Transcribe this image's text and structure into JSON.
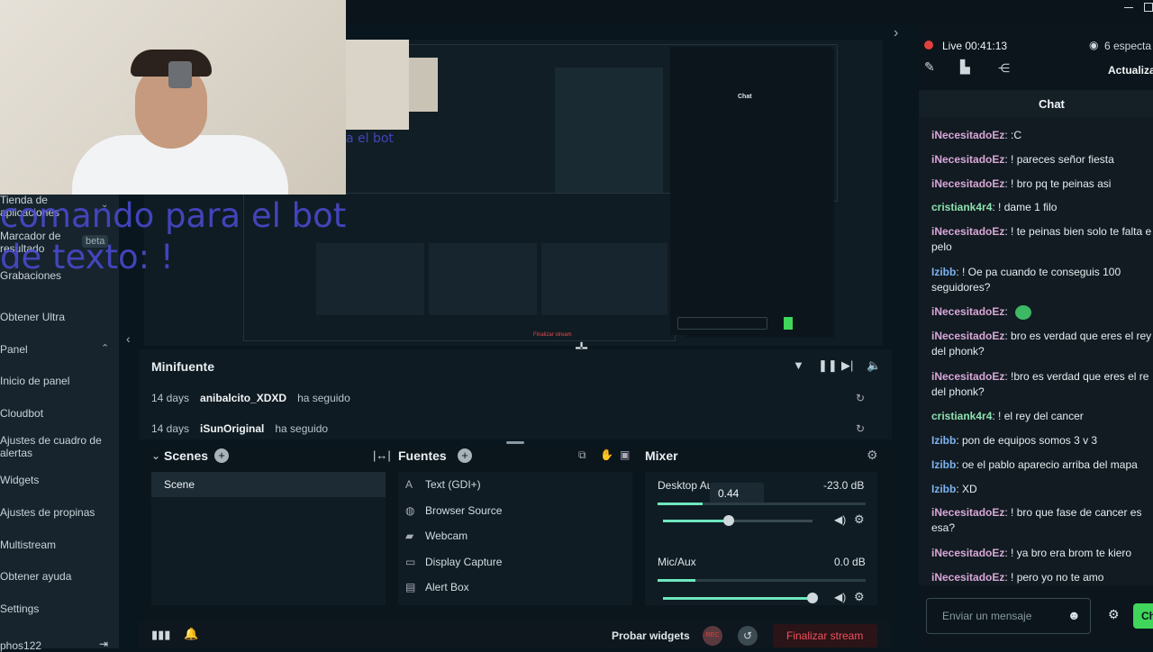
{
  "sidebar": {
    "items": [
      {
        "label": "Tienda de aplicaciones"
      },
      {
        "label": "Marcador de resultado",
        "badge": "beta"
      },
      {
        "label": "Grabaciones"
      },
      {
        "label": "Obtener Ultra"
      },
      {
        "label": "Panel"
      },
      {
        "label": "Inicio de panel"
      },
      {
        "label": "Cloudbot"
      },
      {
        "label": "Ajustes de cuadro de alertas"
      },
      {
        "label": "Widgets"
      },
      {
        "label": "Ajustes de propinas"
      },
      {
        "label": "Multistream"
      },
      {
        "label": "Obtener ayuda"
      },
      {
        "label": "Settings"
      },
      {
        "label": "phos122"
      }
    ]
  },
  "overlay": {
    "line1": "comando para el bot",
    "line2": "de texto: !",
    "small": "a el bot"
  },
  "minifuente": {
    "title": "Minifuente",
    "events": [
      {
        "time": "14 days",
        "user": "anibalcito_XDXD",
        "action": "ha seguido"
      },
      {
        "time": "14 days",
        "user": "iSunOriginal",
        "action": "ha seguido"
      }
    ]
  },
  "scenes": {
    "title": "Scenes",
    "items": [
      "Scene"
    ]
  },
  "sources": {
    "title": "Fuentes",
    "items": [
      {
        "label": "Text (GDI+)",
        "icon": "text-icon"
      },
      {
        "label": "Browser Source",
        "icon": "globe-icon"
      },
      {
        "label": "Webcam",
        "icon": "camera-icon"
      },
      {
        "label": "Display Capture",
        "icon": "monitor-icon"
      },
      {
        "label": "Alert Box",
        "icon": "bell-icon"
      }
    ]
  },
  "mixer": {
    "title": "Mixer",
    "channels": [
      {
        "name": "Desktop Au",
        "db": "-23.0 dB",
        "tooltip": "0.44",
        "level": 0.44
      },
      {
        "name": "Mic/Aux",
        "db": "0.0 dB",
        "level": 1.0
      }
    ]
  },
  "bottombar": {
    "test_widgets": "Probar widgets",
    "rec": "REC",
    "end_stream": "Finalizar stream"
  },
  "stream": {
    "live_label": "Live 00:41:13",
    "viewers": "6 especta",
    "update": "Actualiza"
  },
  "chat": {
    "title": "Chat",
    "messages": [
      {
        "user": "iNecesitadoEz",
        "text": ": :C",
        "color": "a"
      },
      {
        "user": "iNecesitadoEz",
        "text": ": ! pareces señor fiesta",
        "color": "a"
      },
      {
        "user": "iNecesitadoEz",
        "text": ": ! bro pq te peinas asi",
        "color": "a"
      },
      {
        "user": "cristiank4r4",
        "text": ": ! dame 1 filo",
        "color": "b"
      },
      {
        "user": "iNecesitadoEz",
        "text": ": ! te peinas bien solo te falta e pelo",
        "color": "a"
      },
      {
        "user": "Izibb",
        "text": ": ! Oe pa cuando te conseguis 100 seguidores?",
        "color": "c"
      },
      {
        "user": "iNecesitadoEz",
        "text": ":",
        "color": "a"
      },
      {
        "user": "iNecesitadoEz",
        "text": ": bro es verdad que eres el rey del phonk?",
        "color": "a"
      },
      {
        "user": "iNecesitadoEz",
        "text": ": !bro es verdad que eres el re del phonk?",
        "color": "a"
      },
      {
        "user": "cristiank4r4",
        "text": ": ! el rey del cancer",
        "color": "b"
      },
      {
        "user": "Izibb",
        "text": ": pon de equipos somos 3 v 3",
        "color": "c"
      },
      {
        "user": "Izibb",
        "text": ": oe el pablo aparecio arriba del mapa",
        "color": "c"
      },
      {
        "user": "Izibb",
        "text": ": XD",
        "color": "c"
      },
      {
        "user": "iNecesitadoEz",
        "text": ": ! bro que fase de cancer es esa?",
        "color": "a"
      },
      {
        "user": "iNecesitadoEz",
        "text": ": ! ya bro era brom te kiero",
        "color": "a"
      },
      {
        "user": "iNecesitadoEz",
        "text": ": ! pero yo no te amo",
        "color": "a"
      }
    ],
    "input_placeholder": "Enviar un mensaje",
    "send_label": "Ch"
  },
  "colors": {
    "accent": "#31c3a2",
    "live_red": "#e0413c",
    "end_stream": "#e63a46",
    "overlay_text": "#4b4bd4"
  }
}
